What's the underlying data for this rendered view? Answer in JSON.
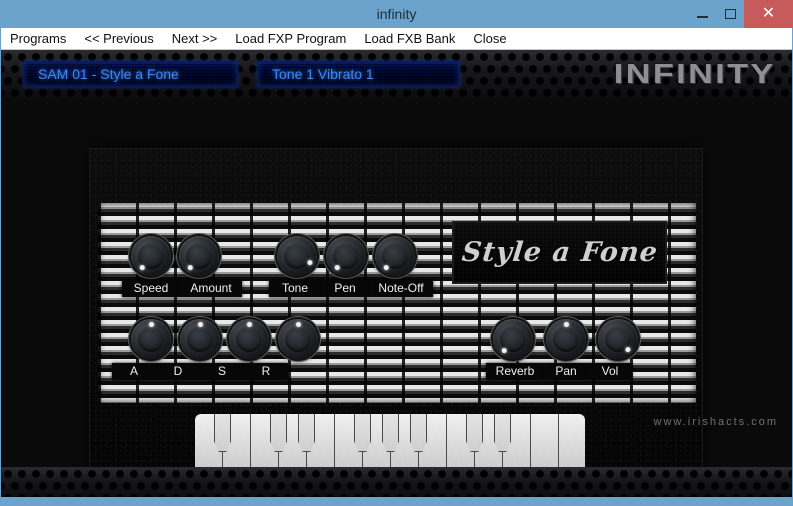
{
  "window": {
    "title": "infinity",
    "controls": {
      "minimize": "–",
      "maximize": "□",
      "close": "✕"
    }
  },
  "menubar": {
    "items": [
      {
        "label": "Programs",
        "name": "menu-programs"
      },
      {
        "label": "<< Previous",
        "name": "menu-previous"
      },
      {
        "label": "Next >>",
        "name": "menu-next"
      },
      {
        "label": "Load FXP Program",
        "name": "menu-load-fxp-program"
      },
      {
        "label": "Load FXB Bank",
        "name": "menu-load-fxb-bank"
      },
      {
        "label": "Close",
        "name": "menu-close"
      }
    ]
  },
  "plugin": {
    "header": {
      "program_display": "SAM 01 - Style a Fone",
      "tone_display": "Tone 1 Vibrato 1",
      "logo": "INFINITY"
    },
    "brand_plate": "Style a Fone",
    "knobs_top": [
      {
        "label": "Speed",
        "angle": 215
      },
      {
        "label": "Amount",
        "angle": 215
      },
      {
        "label": "Tone",
        "angle": 115
      },
      {
        "label": "Pen",
        "angle": 215
      },
      {
        "label": "Note-Off",
        "angle": 215
      }
    ],
    "knobs_bottom": [
      {
        "label": "A",
        "angle": 0
      },
      {
        "label": "D",
        "angle": 0
      },
      {
        "label": "S",
        "angle": 0
      },
      {
        "label": "R",
        "angle": 0
      },
      {
        "label": "Reverb",
        "angle": 215
      },
      {
        "label": "Pan",
        "angle": 0
      },
      {
        "label": "Vol",
        "angle": 135
      }
    ],
    "keyboard": {
      "white_key_count": 14,
      "black_key_pattern": [
        1,
        3,
        4,
        6,
        7,
        8,
        10,
        11
      ]
    },
    "watermark": "www.irishacts.com"
  },
  "colors": {
    "window_chrome": "#6ba3cd",
    "close_button": "#c75a5a",
    "lcd_background": "#00063a",
    "lcd_text": "#3f86ee",
    "logo_gray": "#8e8e94",
    "cabinet_black": "#050505"
  }
}
